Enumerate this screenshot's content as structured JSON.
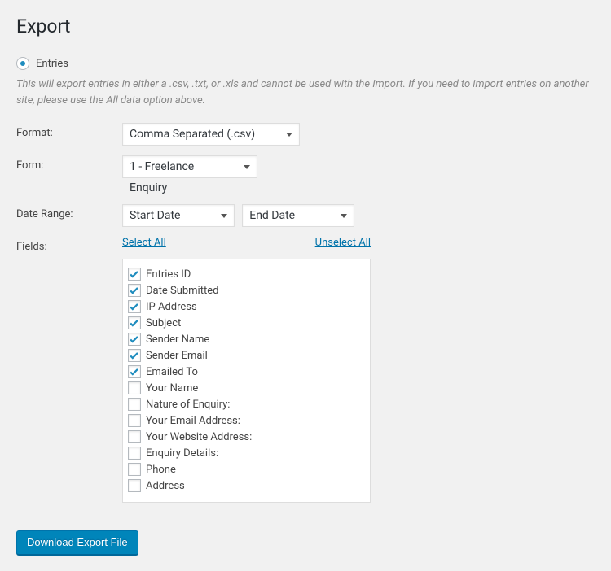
{
  "title": "Export",
  "radio": {
    "entries_label": "Entries",
    "entries_checked": true
  },
  "description": "This will export entries in either a .csv, .txt, or .xls and cannot be used with the Import. If you need to import entries on another site, please use the All data option above.",
  "labels": {
    "format": "Format:",
    "form": "Form:",
    "date_range": "Date Range:",
    "fields": "Fields:"
  },
  "format": {
    "selected": "Comma Separated (.csv)"
  },
  "form": {
    "selected": "1 - Freelance Enquiry"
  },
  "date_range": {
    "start_placeholder": "Start Date",
    "end_placeholder": "End Date"
  },
  "links": {
    "select_all": "Select All",
    "unselect_all": "Unselect All"
  },
  "fields": [
    {
      "label": "Entries ID",
      "checked": true
    },
    {
      "label": "Date Submitted",
      "checked": true
    },
    {
      "label": "IP Address",
      "checked": true
    },
    {
      "label": "Subject",
      "checked": true
    },
    {
      "label": "Sender Name",
      "checked": true
    },
    {
      "label": "Sender Email",
      "checked": true
    },
    {
      "label": "Emailed To",
      "checked": true
    },
    {
      "label": "Your Name",
      "checked": false
    },
    {
      "label": "Nature of Enquiry:",
      "checked": false
    },
    {
      "label": "Your Email Address:",
      "checked": false
    },
    {
      "label": "Your Website Address:",
      "checked": false
    },
    {
      "label": "Enquiry Details:",
      "checked": false
    },
    {
      "label": "Phone",
      "checked": false
    },
    {
      "label": "Address",
      "checked": false
    }
  ],
  "button": {
    "download": "Download Export File"
  }
}
